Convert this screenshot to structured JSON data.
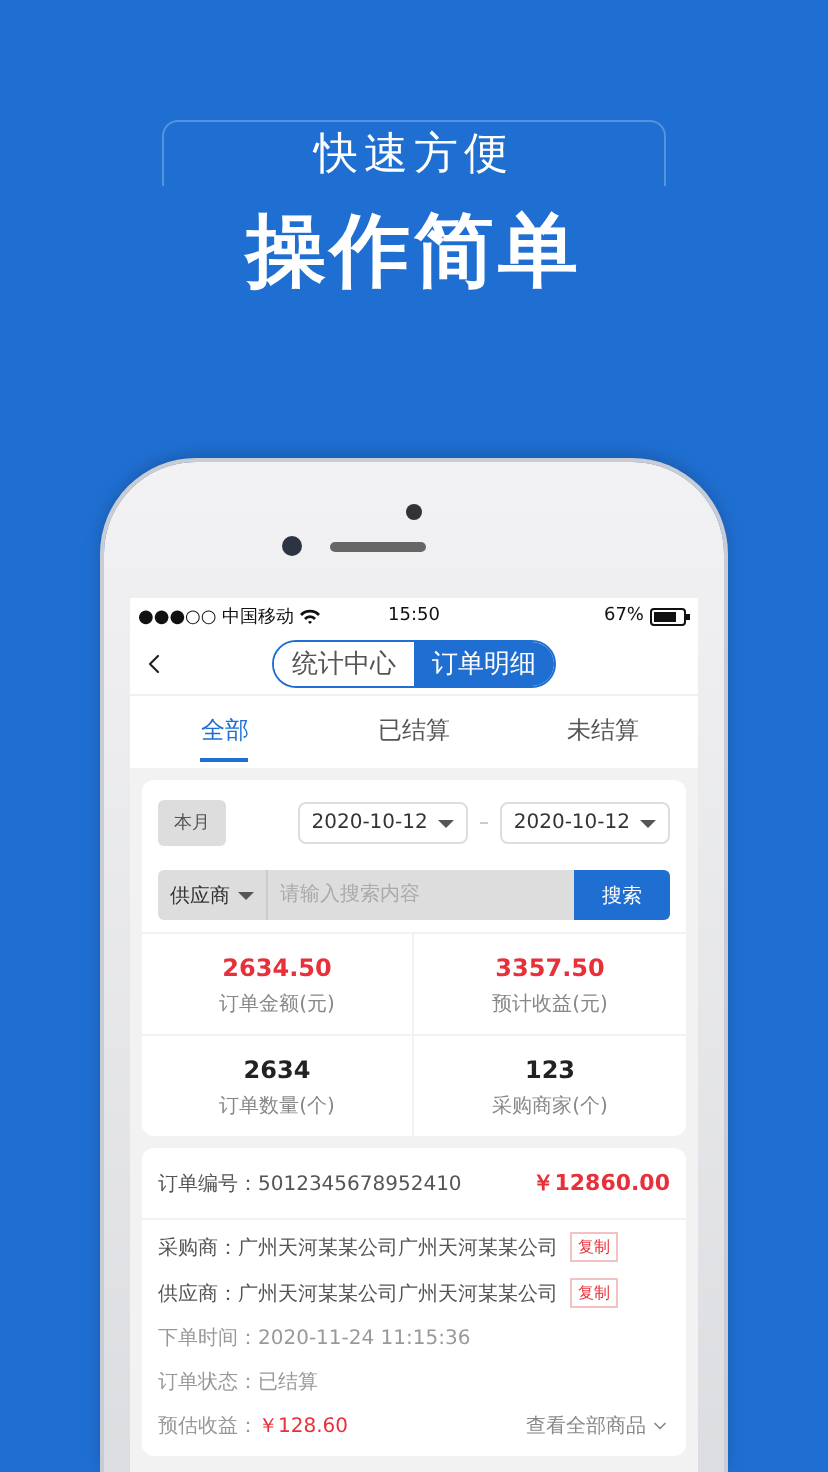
{
  "header": {
    "subtitle": "快速方便",
    "title": "操作简单"
  },
  "status_bar": {
    "carrier": "●●●○○ 中国移动",
    "time": "15:50",
    "battery": "67%"
  },
  "segments": [
    {
      "label": "统计中心",
      "selected": false
    },
    {
      "label": "订单明细",
      "selected": true
    }
  ],
  "tabs": [
    {
      "label": "全部",
      "selected": true
    },
    {
      "label": "已结算",
      "selected": false
    },
    {
      "label": "未结算",
      "selected": false
    }
  ],
  "filter": {
    "period": "本月",
    "start_date": "2020-10-12",
    "end_date": "2020-10-12",
    "search_type": "供应商",
    "placeholder": "请输入搜索内容",
    "search_button": "搜索"
  },
  "stats": [
    {
      "value": "2634.50",
      "label": "订单金额(元)",
      "highlight": true
    },
    {
      "value": "3357.50",
      "label": "预计收益(元)",
      "highlight": true
    },
    {
      "value": "2634",
      "label": "订单数量(个)",
      "highlight": false
    },
    {
      "value": "123",
      "label": "采购商家(个)",
      "highlight": false
    }
  ],
  "orders": [
    {
      "number_label": "订单编号：",
      "number": "5012345678952410",
      "amount": "￥12860.00",
      "lines": [
        {
          "kind": "party",
          "label": "采购商：",
          "value": "广州天河某某公司广州天河某某公司",
          "action": "复制"
        },
        {
          "kind": "party",
          "label": "供应商：",
          "value": "广州天河某某公司广州天河某某公司",
          "action": "复制"
        },
        {
          "kind": "plain",
          "label": "下单时间：",
          "value": "2020-11-24 11:15:36"
        },
        {
          "kind": "plain",
          "label": "订单状态：",
          "value": "已结算"
        }
      ],
      "earnings_label": "预估收益：",
      "earnings": "￥128.60",
      "more": "查看全部商品"
    }
  ]
}
